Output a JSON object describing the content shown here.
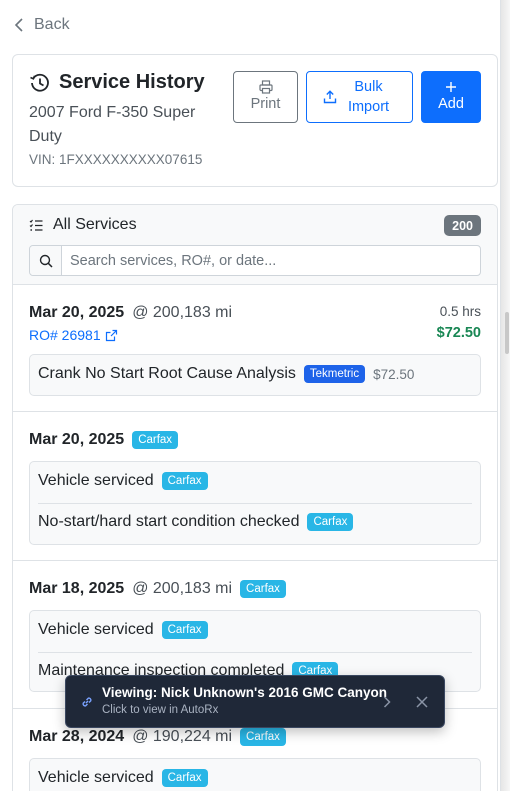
{
  "nav": {
    "back_label": "Back"
  },
  "header": {
    "title": "Service History",
    "vehicle": "2007 Ford F-350 Super Duty",
    "vin": "VIN: 1FXXXXXXXXXX07615",
    "buttons": {
      "print": "Print",
      "bulk_import": "Bulk Import",
      "add": "Add"
    }
  },
  "list": {
    "title": "All Services",
    "count": "200",
    "search_placeholder": "Search services, RO#, or date...",
    "entries": [
      {
        "date": "Mar 20, 2025",
        "mileage": "@ 200,183 mi",
        "ro": "RO# 26981",
        "hours": "0.5 hrs",
        "cost": "$72.50",
        "services": [
          {
            "name": "Crank No Start Root Cause Analysis",
            "source": "Tekmetric",
            "amount": "$72.50"
          }
        ]
      },
      {
        "date": "Mar 20, 2025",
        "source": "Carfax",
        "services": [
          {
            "name": "Vehicle serviced",
            "source": "Carfax"
          },
          {
            "name": "No-start/hard start condition checked",
            "source": "Carfax"
          }
        ]
      },
      {
        "date": "Mar 18, 2025",
        "mileage": "@ 200,183 mi",
        "source": "Carfax",
        "services": [
          {
            "name": "Vehicle serviced",
            "source": "Carfax"
          },
          {
            "name": "Maintenance inspection completed",
            "source": "Carfax"
          }
        ]
      },
      {
        "date": "Mar 28, 2024",
        "mileage": "@ 190,224 mi",
        "source": "Carfax",
        "services": [
          {
            "name": "Vehicle serviced",
            "source": "Carfax"
          }
        ]
      }
    ]
  },
  "toast": {
    "title": "Viewing: Nick Unknown's 2016 GMC Canyon",
    "subtitle": "Click to view in AutoRx"
  },
  "colors": {
    "primary": "#0d6efd",
    "success": "#198754",
    "carfax_badge": "#29b6e6",
    "tekmetric_badge": "#1e63e9",
    "toast_bg": "#1f2838"
  }
}
